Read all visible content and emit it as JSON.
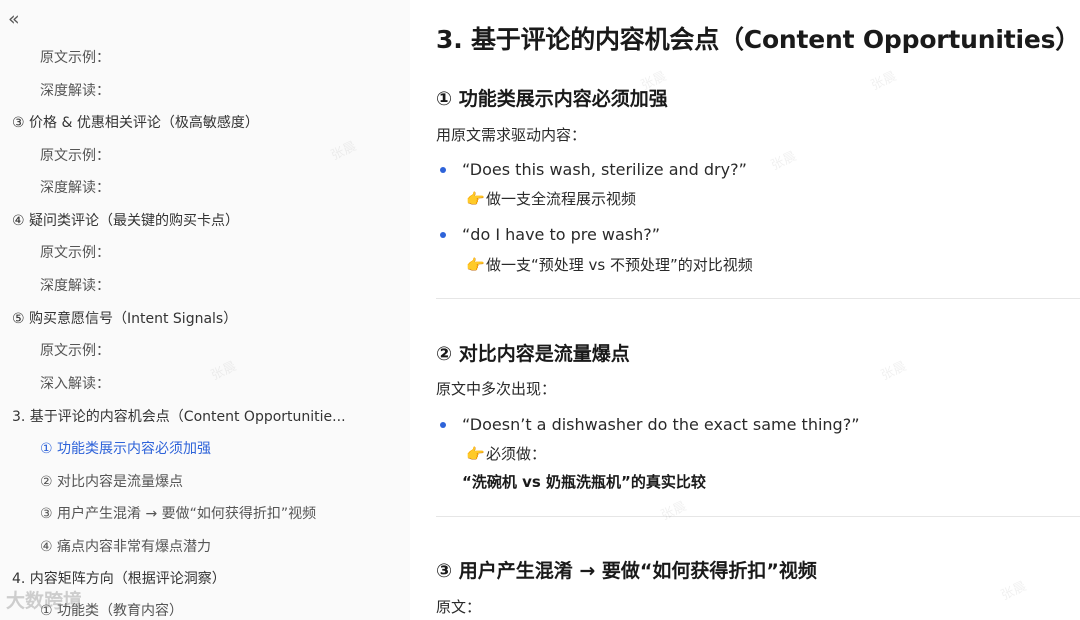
{
  "sidebar": {
    "collapse_icon": "«",
    "items": [
      {
        "label": "原文示例：",
        "level": 2,
        "active": false
      },
      {
        "label": "深度解读：",
        "level": 2,
        "active": false
      },
      {
        "label": "③ 价格 & 优惠相关评论（极高敏感度）",
        "level": 1,
        "active": false
      },
      {
        "label": "原文示例：",
        "level": 2,
        "active": false
      },
      {
        "label": "深度解读：",
        "level": 2,
        "active": false
      },
      {
        "label": "④ 疑问类评论（最关键的购买卡点）",
        "level": 1,
        "active": false
      },
      {
        "label": "原文示例：",
        "level": 2,
        "active": false
      },
      {
        "label": "深度解读：",
        "level": 2,
        "active": false
      },
      {
        "label": "⑤ 购买意愿信号（Intent Signals）",
        "level": 1,
        "active": false
      },
      {
        "label": "原文示例：",
        "level": 2,
        "active": false
      },
      {
        "label": "深入解读：",
        "level": 2,
        "active": false
      },
      {
        "label": "3. 基于评论的内容机会点（Content Opportunitie...",
        "level": 1,
        "active": false
      },
      {
        "label": "① 功能类展示内容必须加强",
        "level": 2,
        "active": true
      },
      {
        "label": "② 对比内容是流量爆点",
        "level": 2,
        "active": false
      },
      {
        "label": "③ 用户产生混淆 → 要做“如何获得折扣”视频",
        "level": 2,
        "active": false
      },
      {
        "label": "④ 痛点内容非常有爆点潜力",
        "level": 2,
        "active": false
      },
      {
        "label": "4. 内容矩阵方向（根据评论洞察）",
        "level": 1,
        "active": false
      },
      {
        "label": "① 功能类（教育内容）",
        "level": 2,
        "active": false
      }
    ]
  },
  "main": {
    "title": "3. 基于评论的内容机会点（Content Opportunities）",
    "sec1": {
      "heading": "① 功能类展示内容必须加强",
      "intro": "用原文需求驱动内容：",
      "bullets": [
        {
          "quote": "“Does this wash, sterilize and dry?”",
          "note": "做一支全流程展示视频"
        },
        {
          "quote": "“do I have to pre wash?”",
          "note": "做一支“预处理 vs 不预处理”的对比视频"
        }
      ]
    },
    "sec2": {
      "heading": "② 对比内容是流量爆点",
      "intro": "原文中多次出现：",
      "quote": "“Doesn’t a dishwasher do the exact same thing?”",
      "note": "必须做：",
      "bold": "“洗碗机 vs 奶瓶洗瓶机”的真实比较"
    },
    "sec3": {
      "heading": "③ 用户产生混淆 → 要做“如何获得折扣”视频",
      "intro": "原文："
    }
  },
  "icons": {
    "pointing_hand": "👉"
  },
  "watermark": "张晨",
  "logo_watermark": "大数跨境",
  "colors": {
    "accent": "#2e63d9",
    "bullet": "#2e63d9",
    "sidebar_bg": "#fafafa"
  }
}
